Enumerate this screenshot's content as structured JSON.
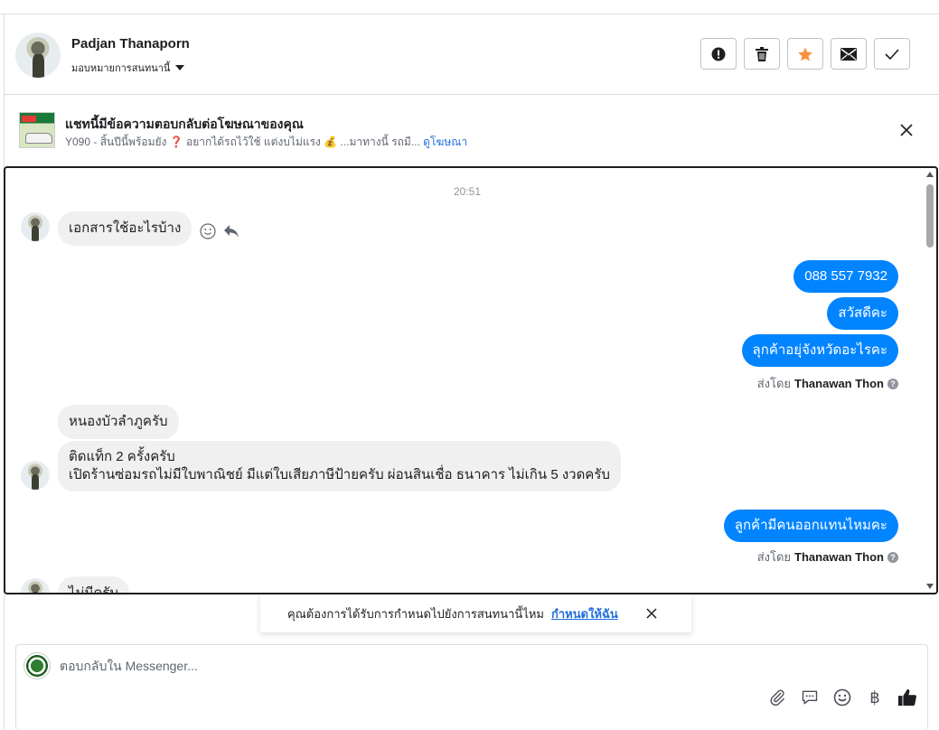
{
  "header": {
    "contact_name": "Padjan Thanaporn",
    "assign_label": "มอบหมายการสนทนานี้",
    "actions": [
      {
        "name": "spam-button",
        "icon": "exclamation-icon"
      },
      {
        "name": "delete-button",
        "icon": "trash-icon"
      },
      {
        "name": "star-button",
        "icon": "star-icon"
      },
      {
        "name": "mark-unread-button",
        "icon": "envelope-icon"
      },
      {
        "name": "mark-done-button",
        "icon": "check-icon"
      }
    ]
  },
  "ad_banner": {
    "title": "แชทนี้มีข้อความตอบกลับต่อโฆษณาของคุณ",
    "description": "Y090 - สิ้นปีนี้พร้อมยัง ❓ อยากได้รถไว้ใช้ แต่งบไม่แรง 💰 ...มาทางนี้ รถมื...",
    "link_label": "ดูโฆษณา"
  },
  "conversation": {
    "timestamp": "20:51",
    "messages": [
      {
        "direction": "in",
        "text": "เอกสารใช้อะไรบ้าง"
      },
      {
        "direction": "out",
        "text": "088 557 7932"
      },
      {
        "direction": "out",
        "text": "สวัสดีคะ"
      },
      {
        "direction": "out",
        "text": "ลุกค้าอยุ่จังหวัดอะไรคะ"
      },
      {
        "direction": "in",
        "text": "หนองบัวลำภูครับ"
      },
      {
        "direction": "in",
        "text": "ติดแท็ก 2 ครั้งครับ"
      },
      {
        "direction": "in",
        "text": "เปิดร้านซ่อมรถไม่มีใบพาณิชย์ มีแต่ใบเสียภาษีป้ายครับ ผ่อนสินเชื่อ ธนาคาร ไม่เกิน 5 งวดครับ"
      },
      {
        "direction": "out",
        "text": "ลูกค้ามีคนออกแทนไหมคะ"
      },
      {
        "direction": "in",
        "text": "ไม่มีครับ"
      }
    ],
    "sent_by_prefix": "ส่งโดย",
    "sent_by_name": "Thanawan Thon"
  },
  "toast": {
    "text": "คุณต้องการได้รับการกำหนดไปยังการสนทนานี้ไหม",
    "link_label": "กำหนดให้ฉัน"
  },
  "composer": {
    "placeholder": "ตอบกลับใน Messenger...",
    "currency_symbol": "฿"
  },
  "colors": {
    "outgoing_bubble": "#0084ff",
    "incoming_bubble": "#f0f0f0",
    "star": "#f7923b",
    "link": "#216fdb"
  }
}
